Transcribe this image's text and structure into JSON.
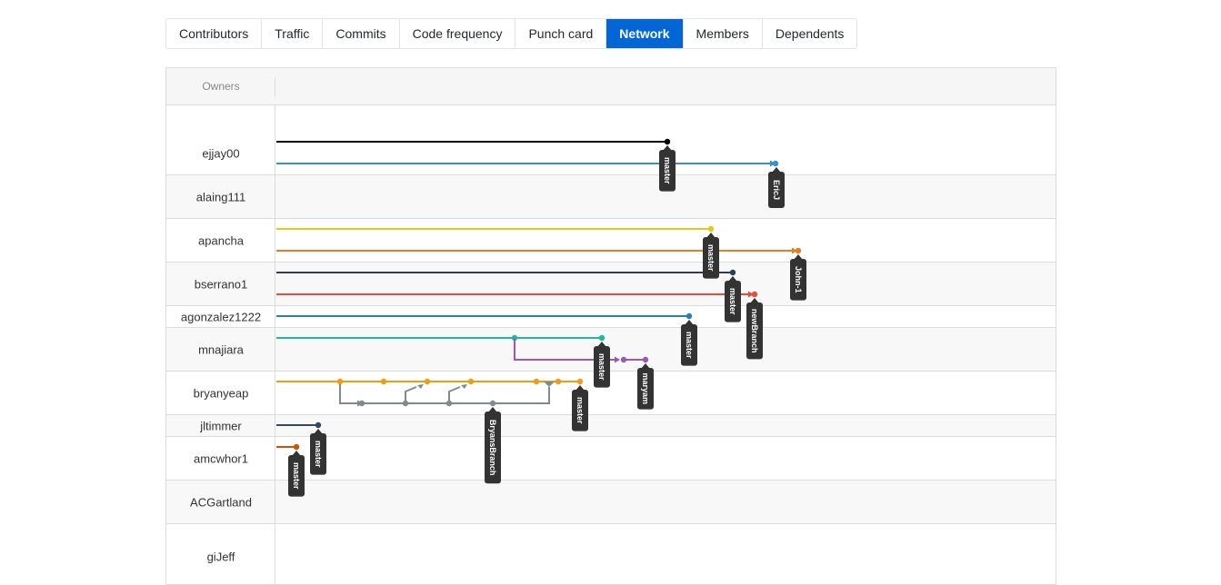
{
  "tabs": [
    {
      "label": "Contributors"
    },
    {
      "label": "Traffic"
    },
    {
      "label": "Commits"
    },
    {
      "label": "Code frequency"
    },
    {
      "label": "Punch card"
    },
    {
      "label": "Network",
      "active": true
    },
    {
      "label": "Members"
    },
    {
      "label": "Dependents"
    }
  ],
  "network": {
    "owners_header": "Owners",
    "owners": [
      {
        "name": "ejjay00"
      },
      {
        "name": "alaing111"
      },
      {
        "name": "apancha"
      },
      {
        "name": "bserrano1"
      },
      {
        "name": "agonzalez1222"
      },
      {
        "name": "mnajiara"
      },
      {
        "name": "bryanyeap"
      },
      {
        "name": "jltimmer"
      },
      {
        "name": "amcwhor1"
      },
      {
        "name": "ACGartland"
      },
      {
        "name": "giJeff"
      }
    ],
    "branches": [
      {
        "owner": "ejjay00",
        "label": "master",
        "color": "#000000"
      },
      {
        "owner": "ejjay00",
        "label": "EricJ",
        "color": "#3a8fd1"
      },
      {
        "owner": "apancha",
        "label": "master",
        "color": "#f1c40f"
      },
      {
        "owner": "apancha",
        "label": "John-1",
        "color": "#e67e22"
      },
      {
        "owner": "bserrano1",
        "label": "master",
        "color": "#2c3e50"
      },
      {
        "owner": "bserrano1",
        "label": "newBranch",
        "color": "#e74c3c"
      },
      {
        "owner": "agonzalez1222",
        "label": "master",
        "color": "#2980b9"
      },
      {
        "owner": "mnajiara",
        "label": "master",
        "color": "#1abc9c"
      },
      {
        "owner": "mnajiara",
        "label": "maryam",
        "color": "#9b59b6"
      },
      {
        "owner": "bryanyeap",
        "label": "master",
        "color": "#f39c12"
      },
      {
        "owner": "bryanyeap",
        "label": "BryansBranch",
        "color": "#7f8c8d"
      },
      {
        "owner": "jltimmer",
        "label": "master",
        "color": "#34495e"
      },
      {
        "owner": "amcwhor1",
        "label": "master",
        "color": "#d35400"
      }
    ],
    "label_bg": "#333333"
  }
}
